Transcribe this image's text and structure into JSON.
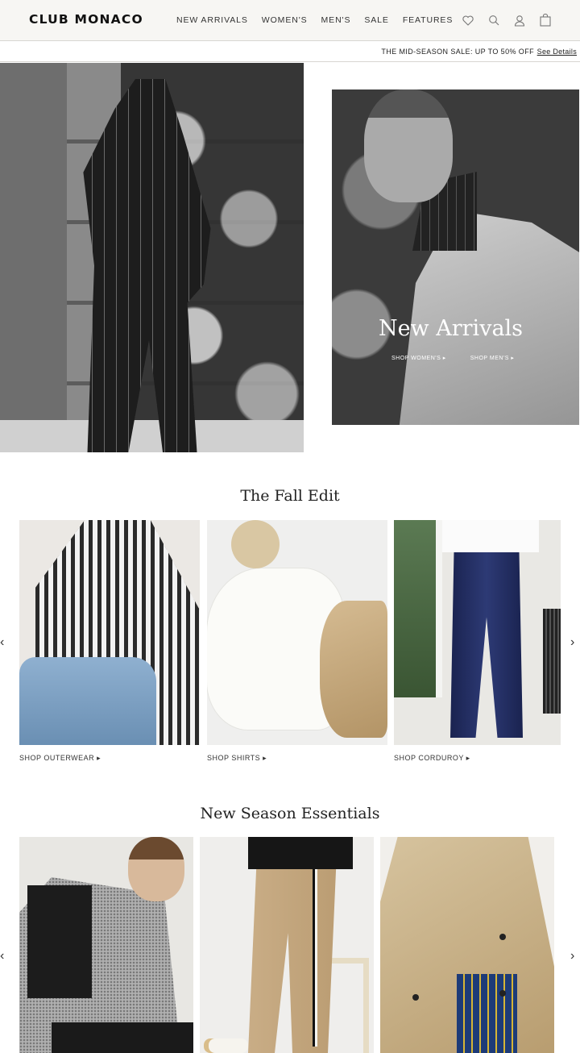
{
  "header": {
    "logo": "CLUB MONACO",
    "nav": [
      "NEW ARRIVALS",
      "WOMEN'S",
      "MEN'S",
      "SALE",
      "FEATURES"
    ],
    "icons": [
      "heart-icon",
      "search-icon",
      "user-icon",
      "bag-icon"
    ]
  },
  "promo": {
    "text": "THE MID-SEASON SALE: UP TO 50% OFF",
    "link": "See Details"
  },
  "hero": {
    "title": "New Arrivals",
    "links": [
      "SHOP WOMEN'S ▸",
      "SHOP MEN'S ▸"
    ]
  },
  "fall_edit": {
    "title": "The Fall Edit",
    "tiles": [
      {
        "label": "SHOP OUTERWEAR ▸"
      },
      {
        "label": "SHOP SHIRTS ▸"
      },
      {
        "label": "SHOP CORDUROY ▸"
      }
    ],
    "prev_arrow": "‹",
    "next_arrow": "›"
  },
  "essentials": {
    "title": "New Season Essentials",
    "prev_arrow": "‹",
    "next_arrow": "›"
  },
  "colors": {
    "header_bg": "#f7f6f3",
    "text": "#222222"
  }
}
